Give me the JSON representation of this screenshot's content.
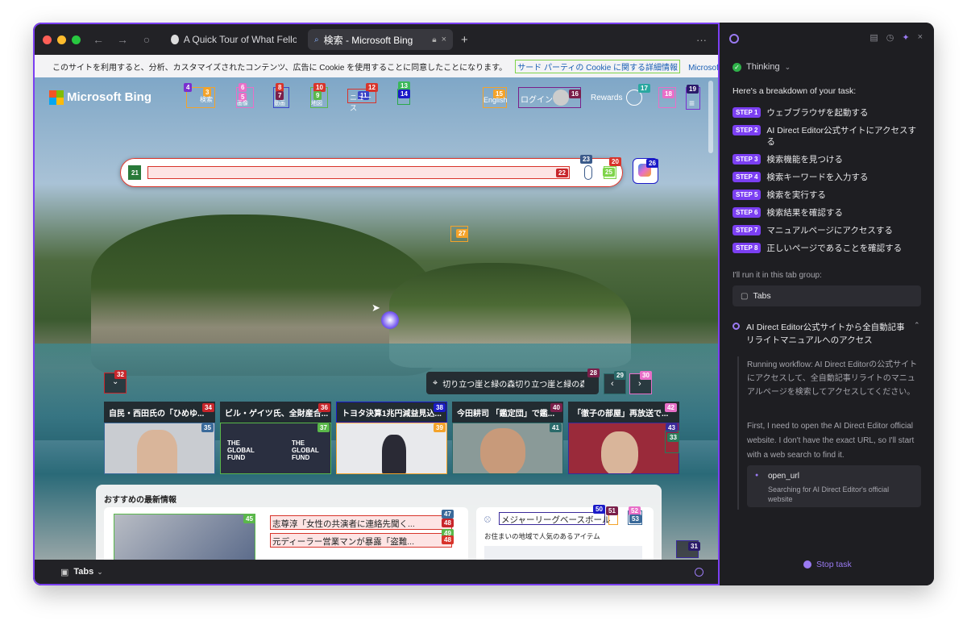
{
  "browser": {
    "tabs": [
      {
        "label": "A Quick Tour of What Fellou Can"
      },
      {
        "label": "検索 - Microsoft Bing"
      }
    ],
    "new_tab": "+",
    "more": "···",
    "cookie_text": "このサイトを利用すると、分析、カスタマイズされたコンテンツ、広告に Cookie を使用することに同意したことになります。",
    "cookie_link": "サード パーティの Cookie に関する詳細情報",
    "cookie_link2": "Microsoft の",
    "bottom_tabs": "Tabs"
  },
  "bing": {
    "logo": "Microsoft Bing",
    "nav": [
      "検索",
      "画像",
      "動画",
      "地図",
      "ニュース"
    ],
    "lang": "English",
    "login": "ログイン",
    "rewards": "Rewards",
    "caption": "切り立つ崖と緑の森切り立つ崖と緑の森",
    "news": [
      {
        "title": "自民・西田氏の「ひめゆ..."
      },
      {
        "title": "ビル・ゲイツ氏、全財産合..."
      },
      {
        "title": "トヨタ決算1兆円減益見込..."
      },
      {
        "title": "今田耕司 「鑑定団」で鑑..."
      },
      {
        "title": "「徹子の部屋」再放送で..."
      }
    ],
    "feed_heading": "おすすめの最新情報",
    "feed_items": [
      "志尊淳「女性の共演者に連絡先聞く...",
      "元ディーラー営業マンが暴露「盗難..."
    ],
    "mlb": "メジャーリーグベースボール",
    "mlb_sub": "お住まいの地域で人気のあるアイテム",
    "global_fund": "THE GLOBAL FUND"
  },
  "marks": [
    "3",
    "4",
    "5",
    "6",
    "7",
    "8",
    "9",
    "10",
    "11",
    "12",
    "13",
    "14",
    "15",
    "16",
    "17",
    "18",
    "19",
    "20",
    "21",
    "22",
    "23",
    "25",
    "26",
    "27",
    "28",
    "29",
    "30",
    "31",
    "32",
    "33",
    "34",
    "35",
    "36",
    "37",
    "38",
    "39",
    "40",
    "41",
    "42",
    "43",
    "45",
    "47",
    "48",
    "49",
    "50",
    "51",
    "52",
    "53"
  ],
  "sidebar": {
    "thinking": "Thinking",
    "intro": "Here's a breakdown of your task:",
    "steps": [
      {
        "tag": "STEP 1",
        "text": "ウェブブラウザを起動する"
      },
      {
        "tag": "STEP 2",
        "text": "AI Direct Editor公式サイトにアクセスする"
      },
      {
        "tag": "STEP 3",
        "text": "検索機能を見つける"
      },
      {
        "tag": "STEP 4",
        "text": "検索キーワードを入力する"
      },
      {
        "tag": "STEP 5",
        "text": "検索を実行する"
      },
      {
        "tag": "STEP 6",
        "text": "検索結果を確認する"
      },
      {
        "tag": "STEP 7",
        "text": "マニュアルページにアクセスする"
      },
      {
        "tag": "STEP 8",
        "text": "正しいページであることを確認する"
      }
    ],
    "group_note": "I'll run it in this tab group:",
    "group_name": "Tabs",
    "workflow_title": "AI Direct Editor公式サイトから全自動記事リライトマニュアルへのアクセス",
    "running": "Running workflow: AI Direct Editorの公式サイトにアクセスして、全自動記事リライトのマニュアルページを検索してアクセスしてください。",
    "first": "First, I need to open the AI Direct Editor official website. I don't have the exact URL, so I'll start with a web search to find it.",
    "tool_name": "open_url",
    "tool_desc": "Searching for AI Direct Editor's official website",
    "stop": "Stop task"
  }
}
